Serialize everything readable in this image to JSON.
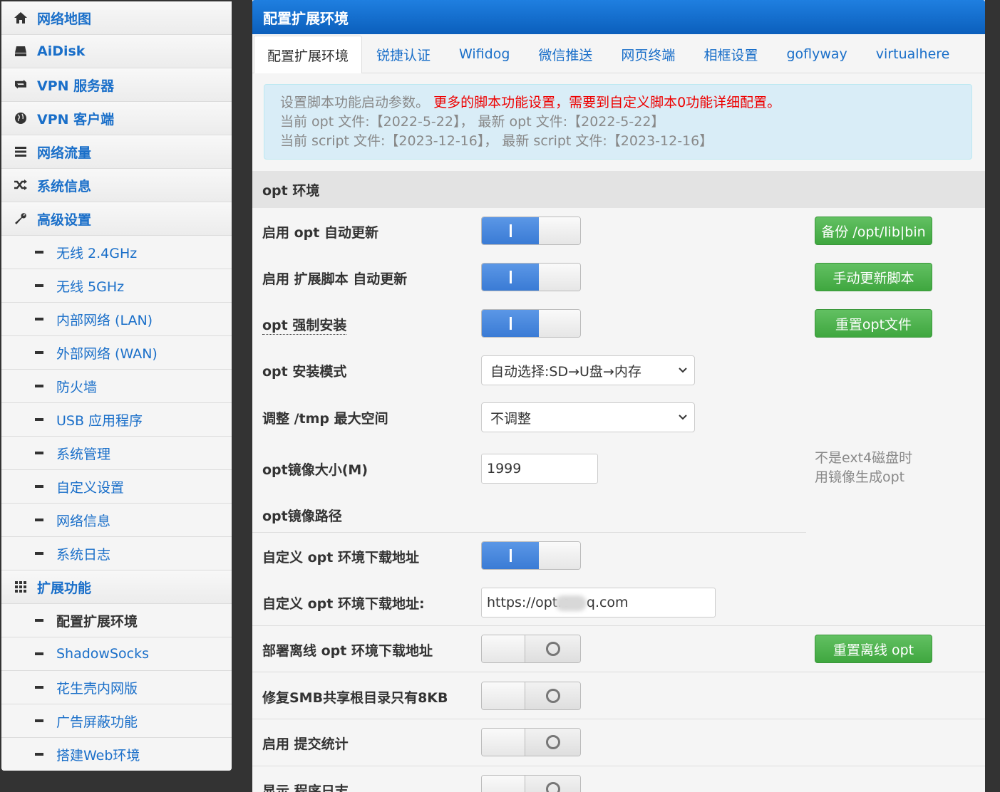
{
  "sidebar": {
    "top_items": [
      {
        "label": "网络地图",
        "icon": "home-icon"
      },
      {
        "label": "AiDisk",
        "icon": "drive-icon"
      },
      {
        "label": "VPN 服务器",
        "icon": "retweet-icon"
      },
      {
        "label": "VPN 客户端",
        "icon": "globe-icon"
      },
      {
        "label": "网络流量",
        "icon": "tasks-icon"
      },
      {
        "label": "系统信息",
        "icon": "random-icon"
      },
      {
        "label": "高级设置",
        "icon": "wrench-icon"
      }
    ],
    "advanced_items": [
      "无线 2.4GHz",
      "无线 5GHz",
      "内部网络 (LAN)",
      "外部网络 (WAN)",
      "防火墙",
      "USB 应用程序",
      "系统管理",
      "自定义设置",
      "网络信息",
      "系统日志"
    ],
    "extension_header": {
      "label": "扩展功能",
      "icon": "grid-icon"
    },
    "extension_items": [
      "配置扩展环境",
      "ShadowSocks",
      "花生壳内网版",
      "广告屏蔽功能",
      "搭建Web环境"
    ],
    "active_item": "配置扩展环境"
  },
  "main": {
    "title": "配置扩展环境",
    "tabs": [
      "配置扩展环境",
      "锐捷认证",
      "Wifidog",
      "微信推送",
      "网页终端",
      "相框设置",
      "goflyway",
      "virtualhere"
    ],
    "info": {
      "line1_normal": "设置脚本功能启动参数。",
      "line1_red": "更多的脚本功能设置，需要到自定义脚本0功能详细配置。",
      "line2": "当前 opt 文件:【2022-5-22】， 最新 opt 文件:【2022-5-22】",
      "line3": "当前 script 文件:【2023-12-16】， 最新 script 文件:【2023-12-16】"
    },
    "section_title": "opt 环境",
    "rows": {
      "opt_auto_update": {
        "label": "启用 opt 自动更新",
        "enabled": true,
        "button": "备份 /opt/lib|bin"
      },
      "script_auto_update": {
        "label": "启用 扩展脚本 自动更新",
        "enabled": true,
        "button": "手动更新脚本"
      },
      "opt_force_install": {
        "label": "opt 强制安装",
        "enabled": true,
        "button": "重置opt文件"
      },
      "opt_install_mode": {
        "label": "opt 安装模式",
        "value": "自动选择:SD→U盘→内存"
      },
      "tmp_max": {
        "label": "调整 /tmp 最大空间",
        "value": "不调整"
      },
      "opt_image_size": {
        "label": "opt镜像大小(M)",
        "value": "1999"
      },
      "opt_image_note1": "不是ext4磁盘时",
      "opt_image_note2": "用镜像生成opt",
      "opt_image_path": {
        "label": "opt镜像路径"
      },
      "custom_opt_url_toggle": {
        "label": "自定义 opt 环境下载地址",
        "enabled": true
      },
      "custom_opt_url": {
        "label": "自定义 opt 环境下载地址:",
        "value": "https://opt.c    q.com"
      },
      "offline_opt": {
        "label": "部署离线 opt 环境下载地址",
        "enabled": false,
        "button": "重置离线 opt"
      },
      "smb_fix": {
        "label": "修复SMB共享根目录只有8KB",
        "enabled": false
      },
      "submit_stats": {
        "label": "启用 提交统计",
        "enabled": false
      },
      "show_log": {
        "label": "显示 程序日志",
        "enabled": false
      }
    }
  }
}
